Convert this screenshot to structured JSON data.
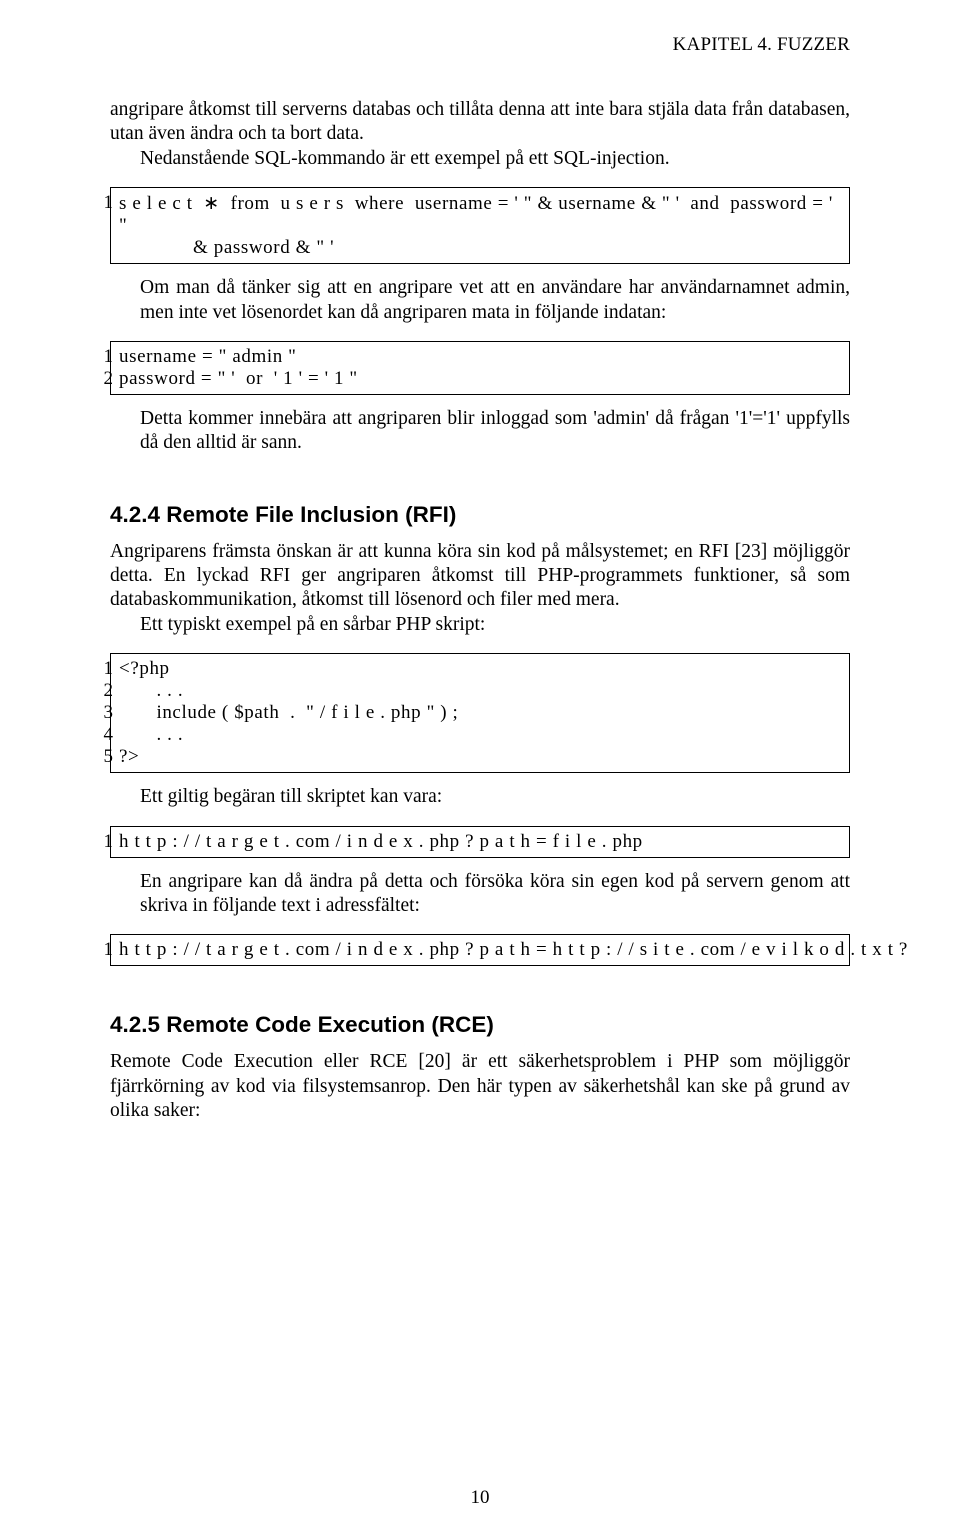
{
  "header": "KAPITEL 4.  FUZZER",
  "para1": "angripare åtkomst till serverns databas och tillåta denna att inte bara stjäla data från databasen, utan även ändra och ta bort data.",
  "para1b": "Nedanstående SQL-kommando är ett exempel på ett SQL-injection.",
  "code1_line1": "s e l e c t  ∗  from  u s e r s  where  username = ' \" & username & \" '  and  password = '  \"",
  "code1_cont": "& password & \" '",
  "para2": "Om man då tänker sig att en angripare vet att en användare har användarnamnet admin, men inte vet lösenordet kan då angriparen mata in följande indatan:",
  "code2_line1": "username = \" admin \"",
  "code2_line2": "password = \" '  or  ' 1 ' = ' 1 \"",
  "para3": "Detta kommer innebära att angriparen blir inloggad som 'admin' då frågan '1'='1' uppfylls då den alltid är sann.",
  "heading1": "4.2.4   Remote File Inclusion (RFI)",
  "para4": "Angriparens främsta önskan är att kunna köra sin kod på målsystemet; en RFI [23] möjliggör detta. En lyckad RFI ger angriparen åtkomst till PHP-programmets funktioner, så som databaskommunikation, åtkomst till lösenord och filer med mera.",
  "para4b": "Ett typiskt exempel på en sårbar PHP skript:",
  "code3_l1": "<?php",
  "code3_l2": "       . . .",
  "code3_l3": "       include ( $path  .  \" / f i l e . php \" ) ;",
  "code3_l4": "       . . .",
  "code3_l5": "?>",
  "para5": "Ett giltig begäran till skriptet kan vara:",
  "code4_l1": "h t t p : / / t a r g e t . com / i n d e x . php ? p a t h = f i l e . php",
  "para6": "En angripare kan då ändra på detta och försöka köra sin egen kod på servern genom att skriva in följande text i adressfältet:",
  "code5_l1": "h t t p : / / t a r g e t . com / i n d e x . php ? p a t h = h t t p : / / s i t e . com / e v i l k o d . t x t ?",
  "heading2": "4.2.5   Remote Code Execution (RCE)",
  "para7": "Remote Code Execution eller RCE [20] är ett säkerhetsproblem i PHP som möjliggör fjärrkörning av kod via filsystemsanrop. Den här typen av säkerhetshål kan ske på grund av olika saker:",
  "page_number": "10"
}
